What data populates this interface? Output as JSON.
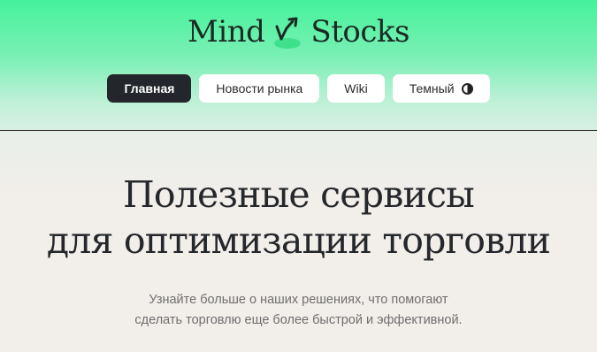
{
  "logo": {
    "text_left": "Mind",
    "text_right": "Stocks",
    "icon": "rising-arrow-icon"
  },
  "nav": {
    "items": [
      {
        "label": "Главная",
        "active": true
      },
      {
        "label": "Новости рынка",
        "active": false
      },
      {
        "label": "Wiki",
        "active": false
      },
      {
        "label": "Темный",
        "active": false,
        "icon": "theme-toggle-icon"
      }
    ]
  },
  "hero": {
    "title_line1": "Полезные сервисы",
    "title_line2": "для оптимизации торговли",
    "subtitle_line1": "Узнайте больше о наших решениях, что помогают",
    "subtitle_line2": "сделать торговлю еще более быстрой и эффективной."
  },
  "colors": {
    "brand_green": "#45f29b",
    "nav_active_bg": "#23262a",
    "page_bg": "#f2eeea"
  }
}
